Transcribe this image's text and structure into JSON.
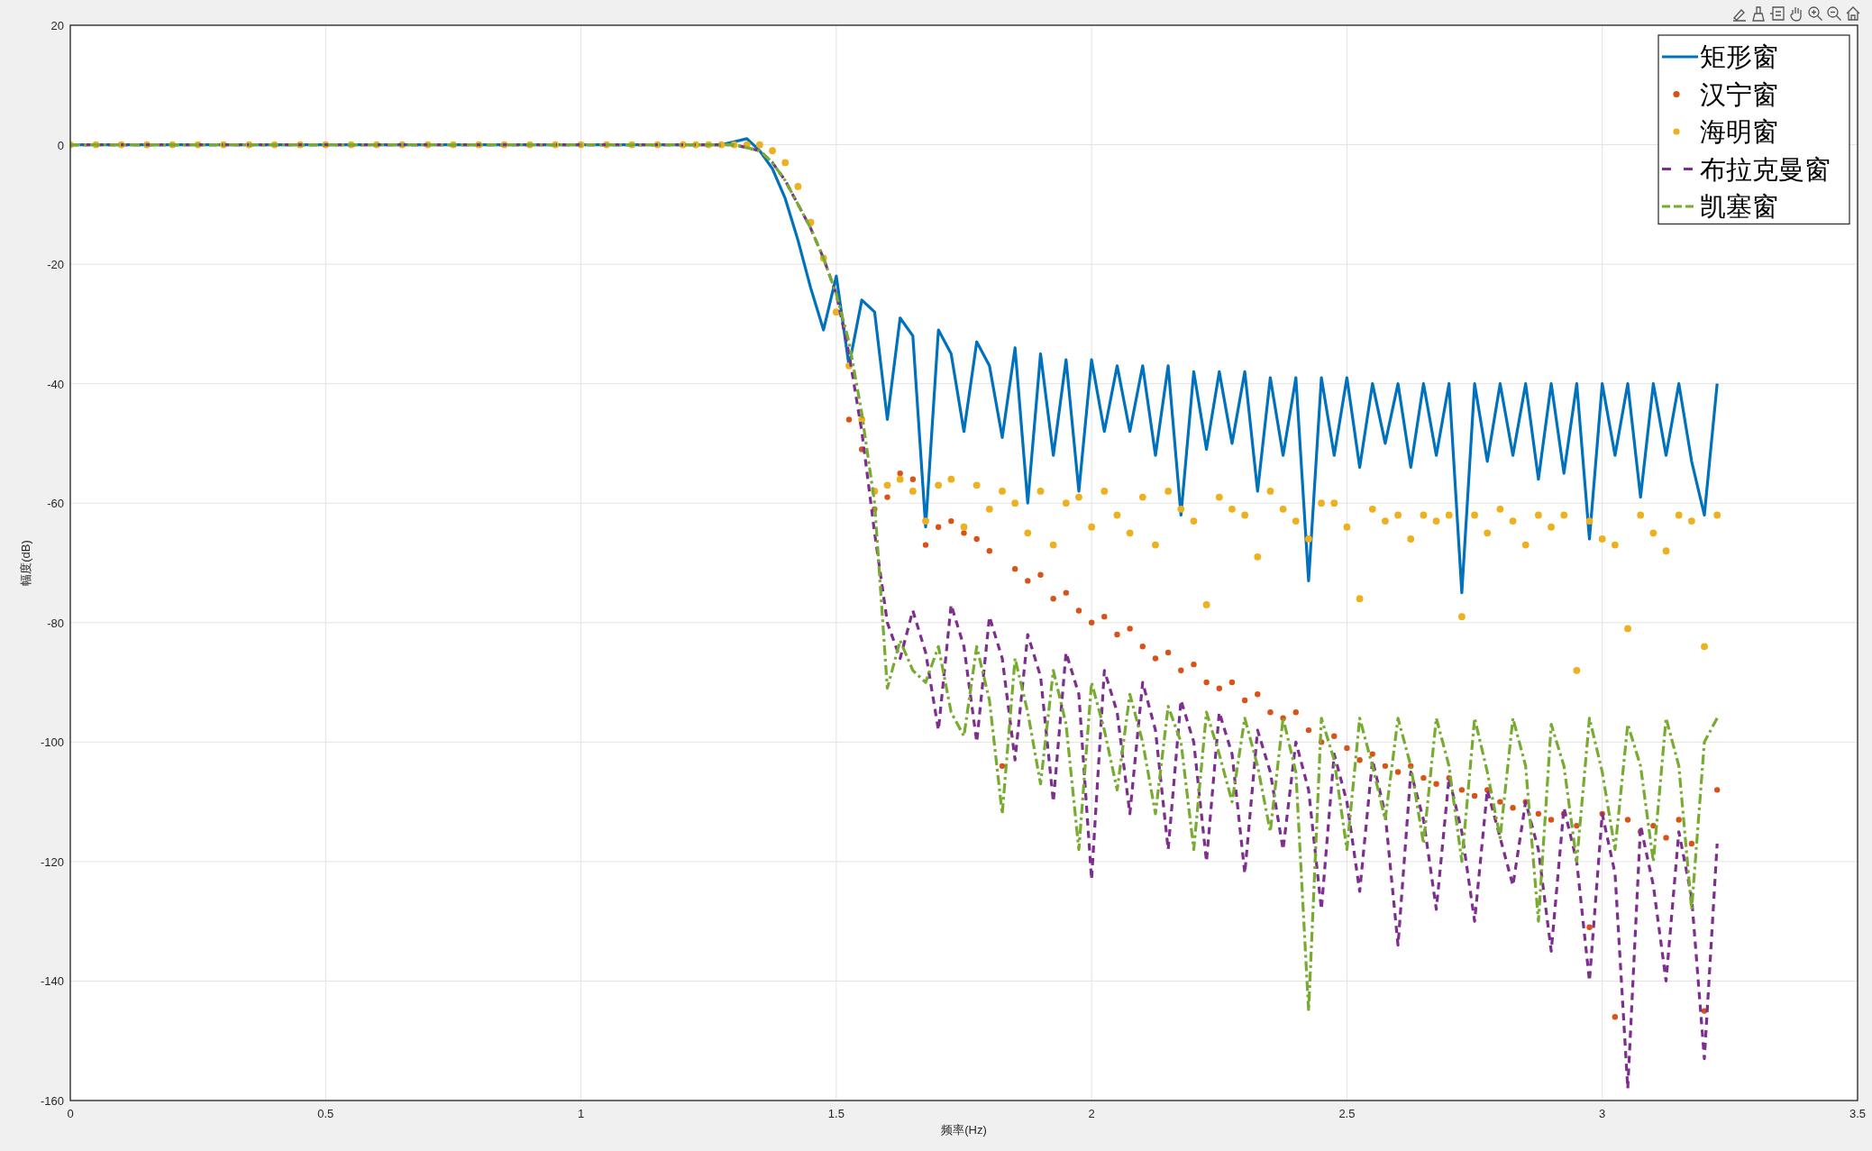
{
  "figure": {
    "chart_data": {
      "type": "line",
      "xlabel": "频率(Hz)",
      "ylabel": "幅度(dB)",
      "xlim": [
        0,
        3.5
      ],
      "ylim": [
        -160,
        20
      ],
      "xticks": [
        0,
        0.5,
        1,
        1.5,
        2,
        2.5,
        3,
        3.5
      ],
      "yticks": [
        -160,
        -140,
        -120,
        -100,
        -80,
        -60,
        -40,
        -20,
        0,
        20
      ],
      "grid": true,
      "legend": true,
      "x": [
        0,
        0.05,
        0.1,
        0.15,
        0.2,
        0.25,
        0.3,
        0.35,
        0.4,
        0.45,
        0.5,
        0.55,
        0.6,
        0.65,
        0.7,
        0.75,
        0.8,
        0.85,
        0.9,
        0.95,
        1,
        1.05,
        1.1,
        1.15,
        1.2,
        1.225,
        1.25,
        1.275,
        1.3,
        1.325,
        1.35,
        1.375,
        1.4,
        1.425,
        1.45,
        1.475,
        1.5,
        1.525,
        1.55,
        1.575,
        1.6,
        1.625,
        1.65,
        1.675,
        1.7,
        1.725,
        1.75,
        1.775,
        1.8,
        1.825,
        1.85,
        1.875,
        1.9,
        1.925,
        1.95,
        1.975,
        2,
        2.025,
        2.05,
        2.075,
        2.1,
        2.125,
        2.15,
        2.175,
        2.2,
        2.225,
        2.25,
        2.275,
        2.3,
        2.325,
        2.35,
        2.375,
        2.4,
        2.425,
        2.45,
        2.475,
        2.5,
        2.525,
        2.55,
        2.575,
        2.6,
        2.625,
        2.65,
        2.675,
        2.7,
        2.725,
        2.75,
        2.775,
        2.8,
        2.825,
        2.85,
        2.875,
        2.9,
        2.925,
        2.95,
        2.975,
        3,
        3.025,
        3.05,
        3.075,
        3.1,
        3.125,
        3.15,
        3.175,
        3.2,
        3.225
      ],
      "series": [
        {
          "name": "矩形窗",
          "line_style": "solid",
          "color": "#0072bd",
          "values": [
            0,
            0,
            0,
            0,
            0,
            0,
            0,
            0,
            0,
            0,
            0,
            0,
            0,
            0,
            0,
            0,
            0,
            0,
            0,
            0,
            0,
            0,
            0,
            0,
            0,
            0,
            0,
            0,
            0.5,
            1,
            -1,
            -4,
            -9,
            -16,
            -24,
            -31,
            -22,
            -37,
            -26,
            -28,
            -46,
            -29,
            -32,
            -64,
            -31,
            -35,
            -48,
            -33,
            -37,
            -49,
            -34,
            -60,
            -35,
            -52,
            -36,
            -58,
            -36,
            -48,
            -37,
            -48,
            -37,
            -52,
            -37,
            -62,
            -38,
            -51,
            -38,
            -50,
            -38,
            -58,
            -39,
            -52,
            -39,
            -73,
            -39,
            -52,
            -39,
            -54,
            -40,
            -50,
            -40,
            -54,
            -40,
            -52,
            -40,
            -75,
            -40,
            -53,
            -40,
            -52,
            -40,
            -56,
            -40,
            -55,
            -40,
            -66,
            -40,
            -52,
            -40,
            -59,
            -40,
            -52,
            -40,
            -53,
            -62,
            -40
          ]
        },
        {
          "name": "汉宁窗",
          "type": "scatter",
          "marker": "circle",
          "color": "#d95319",
          "values": [
            null,
            null,
            null,
            null,
            null,
            null,
            null,
            null,
            null,
            null,
            null,
            null,
            null,
            null,
            null,
            null,
            null,
            null,
            null,
            null,
            null,
            null,
            null,
            null,
            null,
            null,
            null,
            null,
            null,
            null,
            null,
            null,
            null,
            null,
            null,
            null,
            null,
            -46,
            -51,
            -61,
            -59,
            -55,
            -56,
            -67,
            -64,
            -63,
            -65,
            -66,
            -68,
            -104,
            -71,
            -73,
            -72,
            -76,
            -75,
            -78,
            -80,
            -79,
            -82,
            -81,
            -84,
            -86,
            -85,
            -88,
            -87,
            -90,
            -91,
            -90,
            -93,
            -92,
            -95,
            -96,
            -95,
            -98,
            -100,
            -99,
            -101,
            -103,
            -102,
            -104,
            -105,
            -104,
            -106,
            -107,
            -106,
            -108,
            -109,
            -108,
            -110,
            -111,
            -110,
            -112,
            -113,
            -112,
            -114,
            -131,
            -112,
            -146,
            -113,
            -115,
            -114,
            -116,
            -113,
            -117,
            -145,
            -108
          ]
        },
        {
          "name": "海明窗",
          "type": "scatter",
          "marker": "circle",
          "color": "#edb120",
          "values": [
            0,
            0,
            0,
            0,
            0,
            0,
            0,
            0,
            0,
            0,
            0,
            0,
            0,
            0,
            0,
            0,
            0,
            0,
            0,
            0,
            0,
            0,
            0,
            0,
            0,
            0,
            0,
            0,
            0,
            0,
            0,
            -1,
            -3,
            -7,
            -13,
            -19,
            -28,
            -37,
            -46,
            -58,
            -57,
            -56,
            -58,
            -63,
            -57,
            -56,
            -64,
            -57,
            -61,
            -58,
            -60,
            -65,
            -58,
            -67,
            -60,
            -59,
            -64,
            -58,
            -62,
            -65,
            -59,
            -67,
            -58,
            -61,
            -63,
            -77,
            -59,
            -61,
            -62,
            -69,
            -58,
            -61,
            -63,
            -66,
            -60,
            -60,
            -64,
            -76,
            -61,
            -63,
            -62,
            -66,
            -62,
            -63,
            -62,
            -79,
            -62,
            -65,
            -61,
            -63,
            -67,
            -62,
            -64,
            -62,
            -88,
            -63,
            -66,
            -67,
            -81,
            -62,
            -65,
            -68,
            -62,
            -63,
            -84,
            -62
          ]
        },
        {
          "name": "布拉克曼窗",
          "line_style": "dashed",
          "color": "#7e2f8e",
          "values": [
            0,
            0,
            0,
            0,
            0,
            0,
            0,
            0,
            0,
            0,
            0,
            0,
            0,
            0,
            0,
            0,
            0,
            0,
            0,
            0,
            0,
            0,
            0,
            0,
            0,
            0,
            0,
            0,
            0,
            -0.5,
            -1,
            -3,
            -6,
            -10,
            -14,
            -19,
            -25,
            -35,
            -48,
            -65,
            -80,
            -86,
            -78,
            -85,
            -98,
            -77,
            -84,
            -100,
            -79,
            -86,
            -103,
            -82,
            -89,
            -110,
            -85,
            -92,
            -123,
            -88,
            -95,
            -112,
            -90,
            -98,
            -118,
            -93,
            -100,
            -120,
            -95,
            -102,
            -122,
            -98,
            -105,
            -118,
            -100,
            -108,
            -128,
            -102,
            -110,
            -125,
            -103,
            -112,
            -134,
            -105,
            -113,
            -128,
            -106,
            -115,
            -130,
            -108,
            -116,
            -124,
            -110,
            -118,
            -135,
            -111,
            -120,
            -140,
            -112,
            -122,
            -158,
            -114,
            -124,
            -140,
            -115,
            -126,
            -153,
            -117
          ]
        },
        {
          "name": "凯塞窗",
          "line_style": "dashdot",
          "color": "#77ac30",
          "values": [
            0,
            0,
            0,
            0,
            0,
            0,
            0,
            0,
            0,
            0,
            0,
            0,
            0,
            0,
            0,
            0,
            0,
            0,
            0,
            0,
            0,
            0,
            0,
            0,
            0,
            0,
            0,
            0,
            0,
            -0.5,
            -1,
            -3,
            -6,
            -10,
            -14,
            -19,
            -25,
            -33,
            -45,
            -60,
            -91,
            -83,
            -88,
            -90,
            -84,
            -95,
            -99,
            -84,
            -93,
            -112,
            -86,
            -95,
            -107,
            -88,
            -97,
            -118,
            -90,
            -98,
            -108,
            -92,
            -100,
            -112,
            -94,
            -100,
            -118,
            -95,
            -102,
            -110,
            -96,
            -104,
            -115,
            -96,
            -105,
            -145,
            -96,
            -103,
            -118,
            -96,
            -104,
            -113,
            -96,
            -104,
            -117,
            -96,
            -104,
            -120,
            -96,
            -105,
            -116,
            -96,
            -104,
            -130,
            -97,
            -104,
            -120,
            -96,
            -105,
            -118,
            -97,
            -104,
            -120,
            -96,
            -104,
            -128,
            -100,
            -96
          ]
        }
      ]
    }
  }
}
